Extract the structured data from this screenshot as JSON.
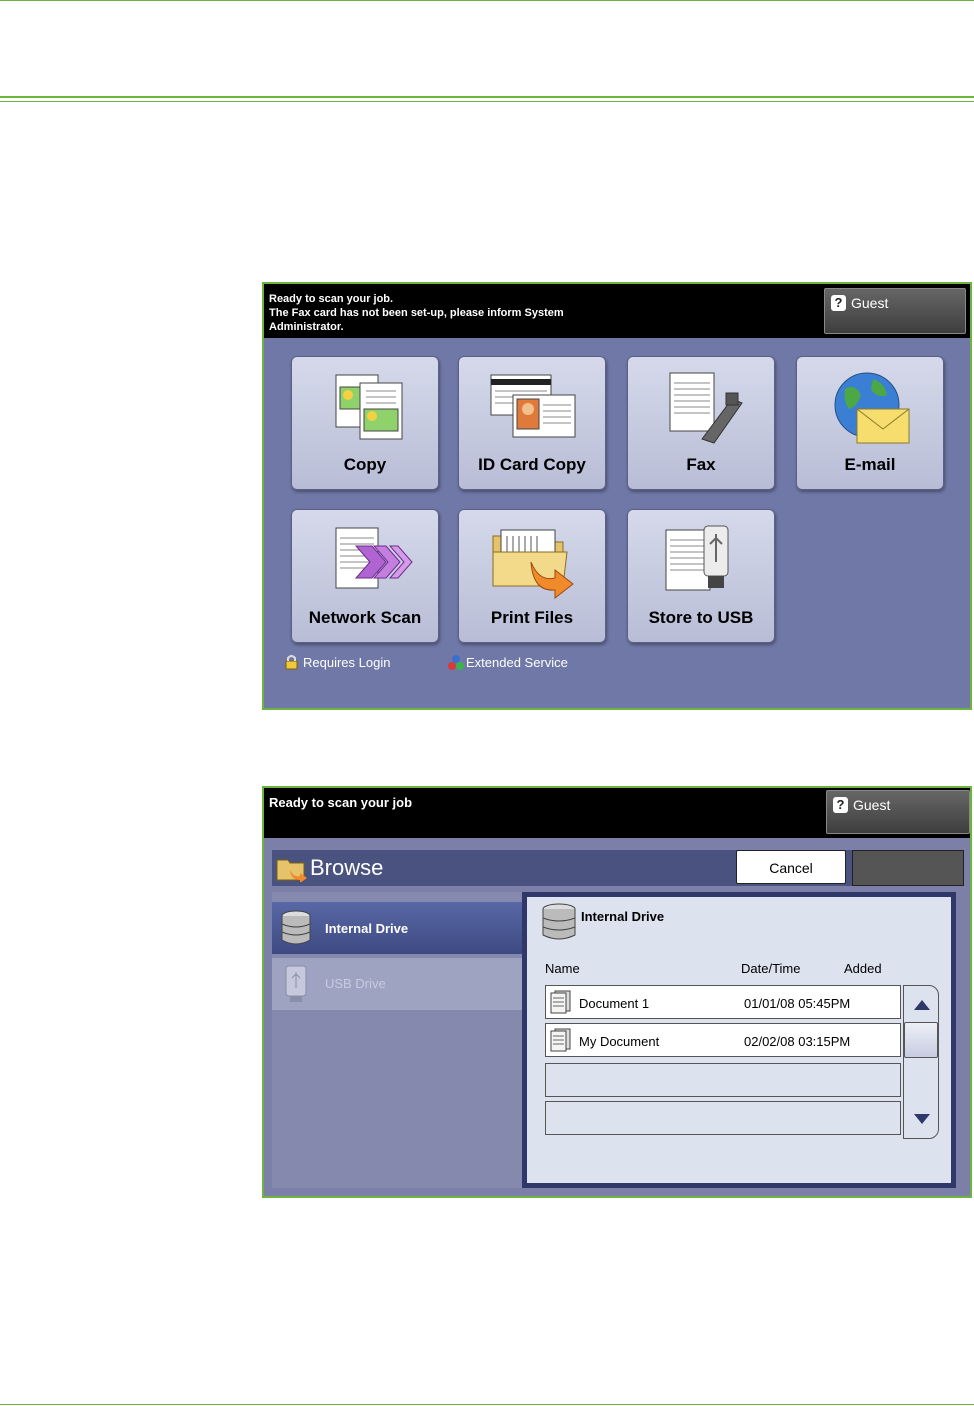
{
  "panel1": {
    "status_lines": [
      "Ready to scan your job.",
      "The Fax card has not been set-up, please inform System",
      "Administrator."
    ],
    "guest_label": "Guest",
    "tiles": [
      {
        "label": "Copy",
        "icon": "copy-icon"
      },
      {
        "label": "ID Card Copy",
        "icon": "id-card-icon"
      },
      {
        "label": "Fax",
        "icon": "fax-icon"
      },
      {
        "label": "E-mail",
        "icon": "email-icon"
      },
      {
        "label": "Network Scan",
        "icon": "network-scan-icon"
      },
      {
        "label": "Print Files",
        "icon": "print-files-icon"
      },
      {
        "label": "Store to USB",
        "icon": "store-usb-icon"
      }
    ],
    "legend": {
      "requires_login": "Requires Login",
      "extended_service": "Extended Service"
    }
  },
  "panel2": {
    "status": "Ready to scan your job",
    "guest_label": "Guest",
    "browse_title": "Browse",
    "cancel_label": "Cancel",
    "drives": [
      {
        "label": "Internal Drive",
        "selected": true
      },
      {
        "label": "USB Drive",
        "selected": false
      }
    ],
    "right_title": "Internal Drive",
    "columns": {
      "name": "Name",
      "datetime": "Date/Time",
      "added": "Added"
    },
    "files": [
      {
        "name": "Document 1",
        "datetime": "01/01/08 05:45PM"
      },
      {
        "name": "My Document",
        "datetime": "02/02/08 03:15PM"
      }
    ]
  },
  "colors": {
    "border_green": "#6db33f",
    "panel_bg": "#7078a7",
    "tile_bg": "#c8cce0"
  }
}
